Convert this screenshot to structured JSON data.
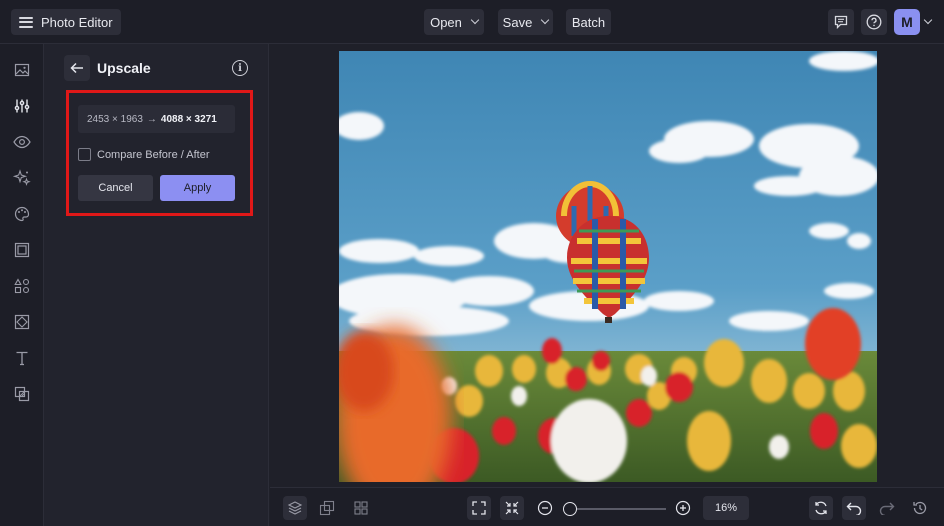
{
  "topbar": {
    "app_label": "Photo Editor",
    "open_label": "Open",
    "save_label": "Save",
    "batch_label": "Batch",
    "avatar_initial": "M"
  },
  "rail": {
    "icons": [
      "image-icon",
      "adjustments-icon",
      "eye-icon",
      "sparkle-effects-icon",
      "palette-icon",
      "frame-icon",
      "shapes-icon",
      "texture-icon",
      "text-icon",
      "overlay-icon"
    ]
  },
  "panel": {
    "title": "Upscale",
    "original_size": "2453 × 1963",
    "arrow": "→",
    "new_size": "4088 × 3271",
    "compare_label": "Compare Before / After",
    "compare_checked": false,
    "cancel_label": "Cancel",
    "apply_label": "Apply"
  },
  "bottombar": {
    "zoom_label": "16%",
    "zoom_level": 0.16
  },
  "colors": {
    "accent": "#8c8ff2",
    "highlight": "#e01818",
    "bg": "#1f2029"
  }
}
